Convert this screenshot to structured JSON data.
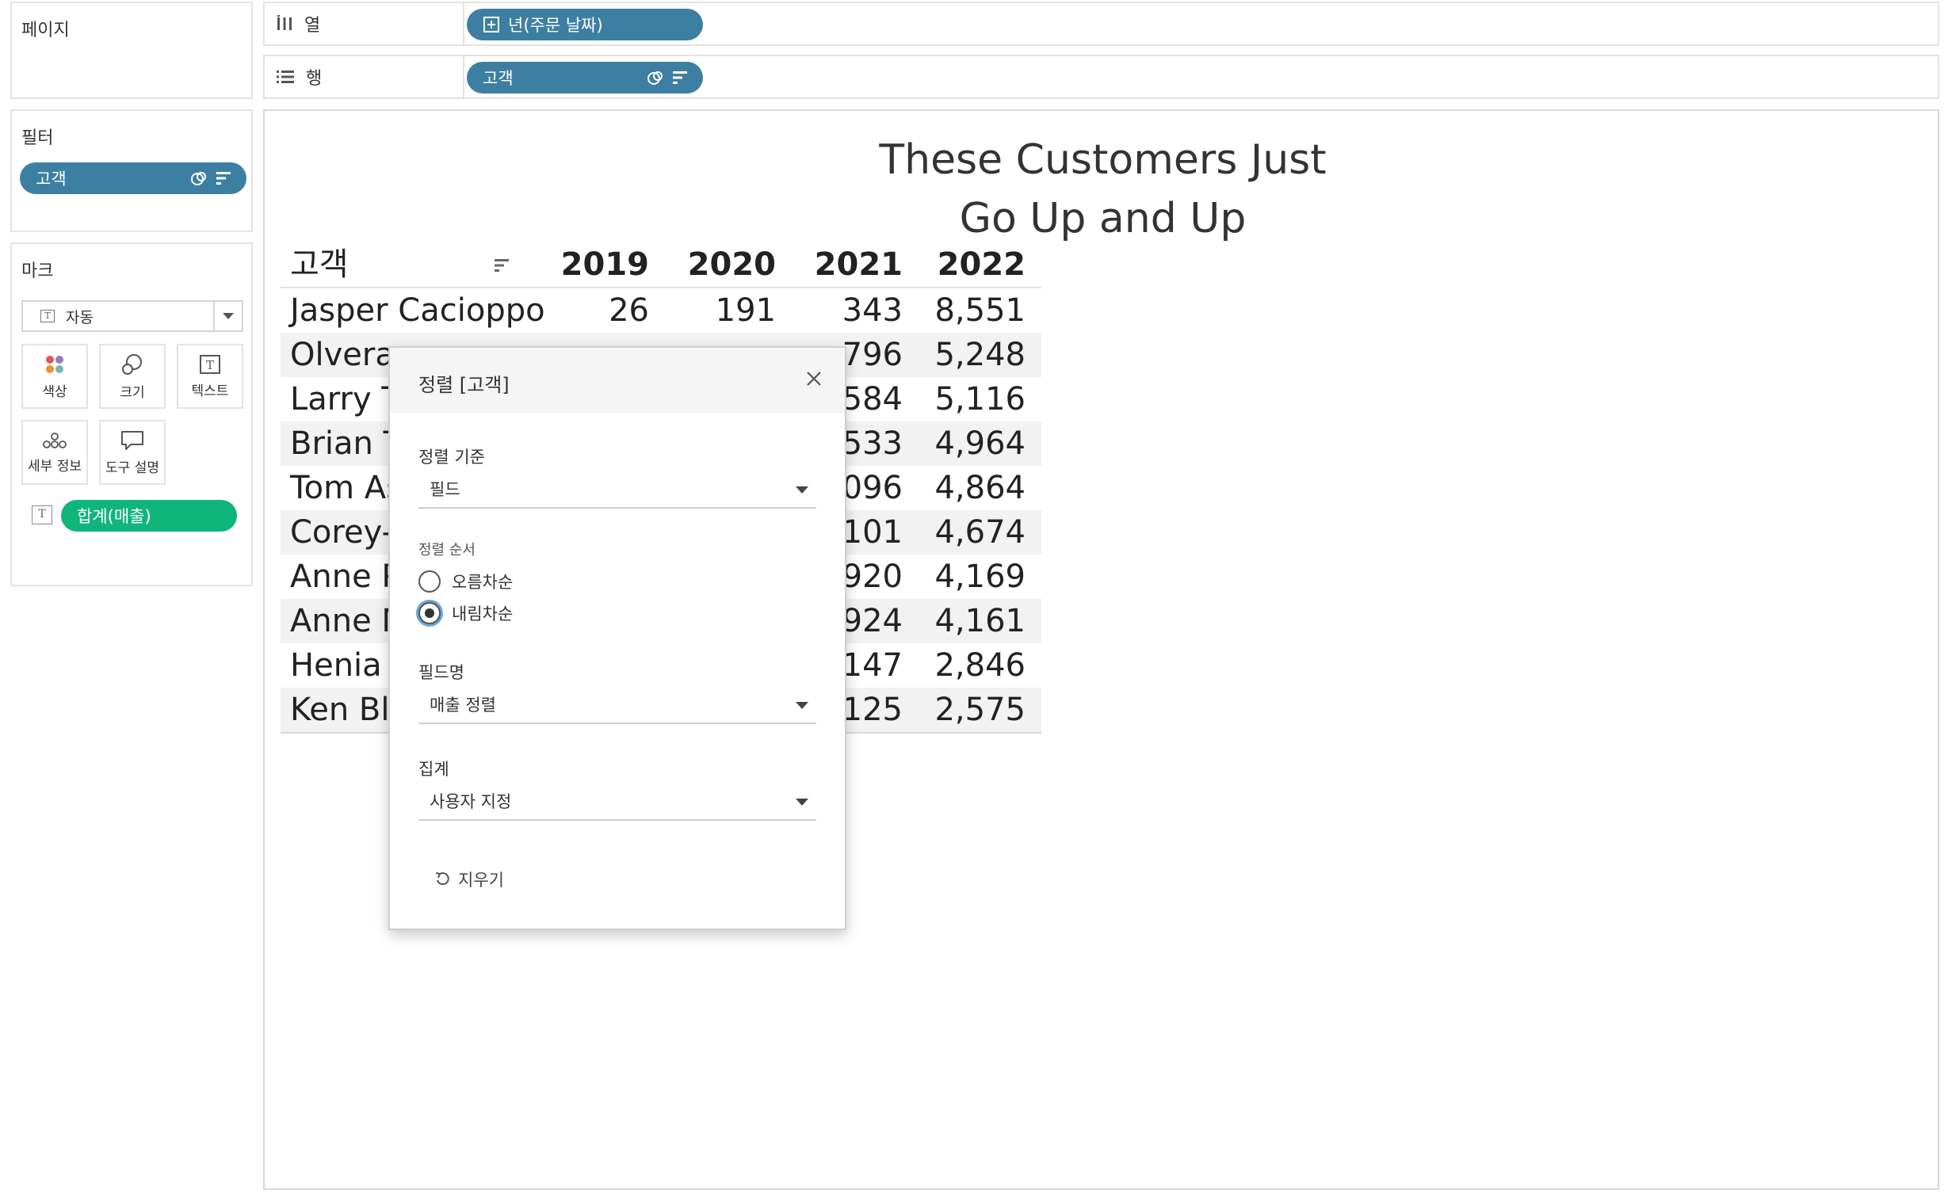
{
  "left_panel": {
    "pages_title": "페이지",
    "filters_title": "필터",
    "filter_pill": "고객",
    "marks_title": "마크",
    "mark_type": "자동",
    "mark_buttons": {
      "color": "색상",
      "size": "크기",
      "text": "텍스트",
      "detail": "세부 정보",
      "tooltip": "도구 설명"
    },
    "text_pill": "합계(매출)"
  },
  "shelves": {
    "columns_label": "열",
    "columns_pill": "년(주문 날짜)",
    "rows_label": "행",
    "rows_pill": "고객"
  },
  "viz": {
    "title_line1": "These Customers Just",
    "title_line2": "Go Up and Up",
    "header": {
      "customer": "고객",
      "years": [
        "2019",
        "2020",
        "2021",
        "2022"
      ]
    },
    "rows": [
      {
        "name": "Jasper Cacioppo",
        "values": [
          "26",
          "191",
          "343",
          "8,551"
        ]
      },
      {
        "name": "Olvera",
        "values": [
          "",
          "",
          "796",
          "5,248"
        ]
      },
      {
        "name": "Larry T",
        "values": [
          "",
          "",
          "584",
          "5,116"
        ]
      },
      {
        "name": "Brian T",
        "values": [
          "",
          "",
          "533",
          "4,964"
        ]
      },
      {
        "name": "Tom As",
        "values": [
          "",
          "",
          "096",
          "4,864"
        ]
      },
      {
        "name": "Corey-",
        "values": [
          "",
          "",
          "101",
          "4,674"
        ]
      },
      {
        "name": "Anne P",
        "values": [
          "",
          "",
          "920",
          "4,169"
        ]
      },
      {
        "name": "Anne M",
        "values": [
          "",
          "",
          "924",
          "4,161"
        ]
      },
      {
        "name": "Henia Z",
        "values": [
          "",
          "",
          "147",
          "2,846"
        ]
      },
      {
        "name": "Ken Bla",
        "values": [
          "",
          "",
          "125",
          "2,575"
        ]
      }
    ]
  },
  "dialog": {
    "title": "정렬 [고객]",
    "sort_by_label": "정렬 기준",
    "sort_by_value": "필드",
    "sort_order_label": "정렬 순서",
    "ascending": "오름차순",
    "descending": "내림차순",
    "field_name_label": "필드명",
    "field_name_value": "매출 정렬",
    "aggregation_label": "집계",
    "aggregation_value": "사용자 지정",
    "clear": "지우기"
  },
  "colors": {
    "pill_blue": "#3d7fa3",
    "pill_green": "#0fb57b",
    "focus_ring": "#6aa6d6"
  }
}
